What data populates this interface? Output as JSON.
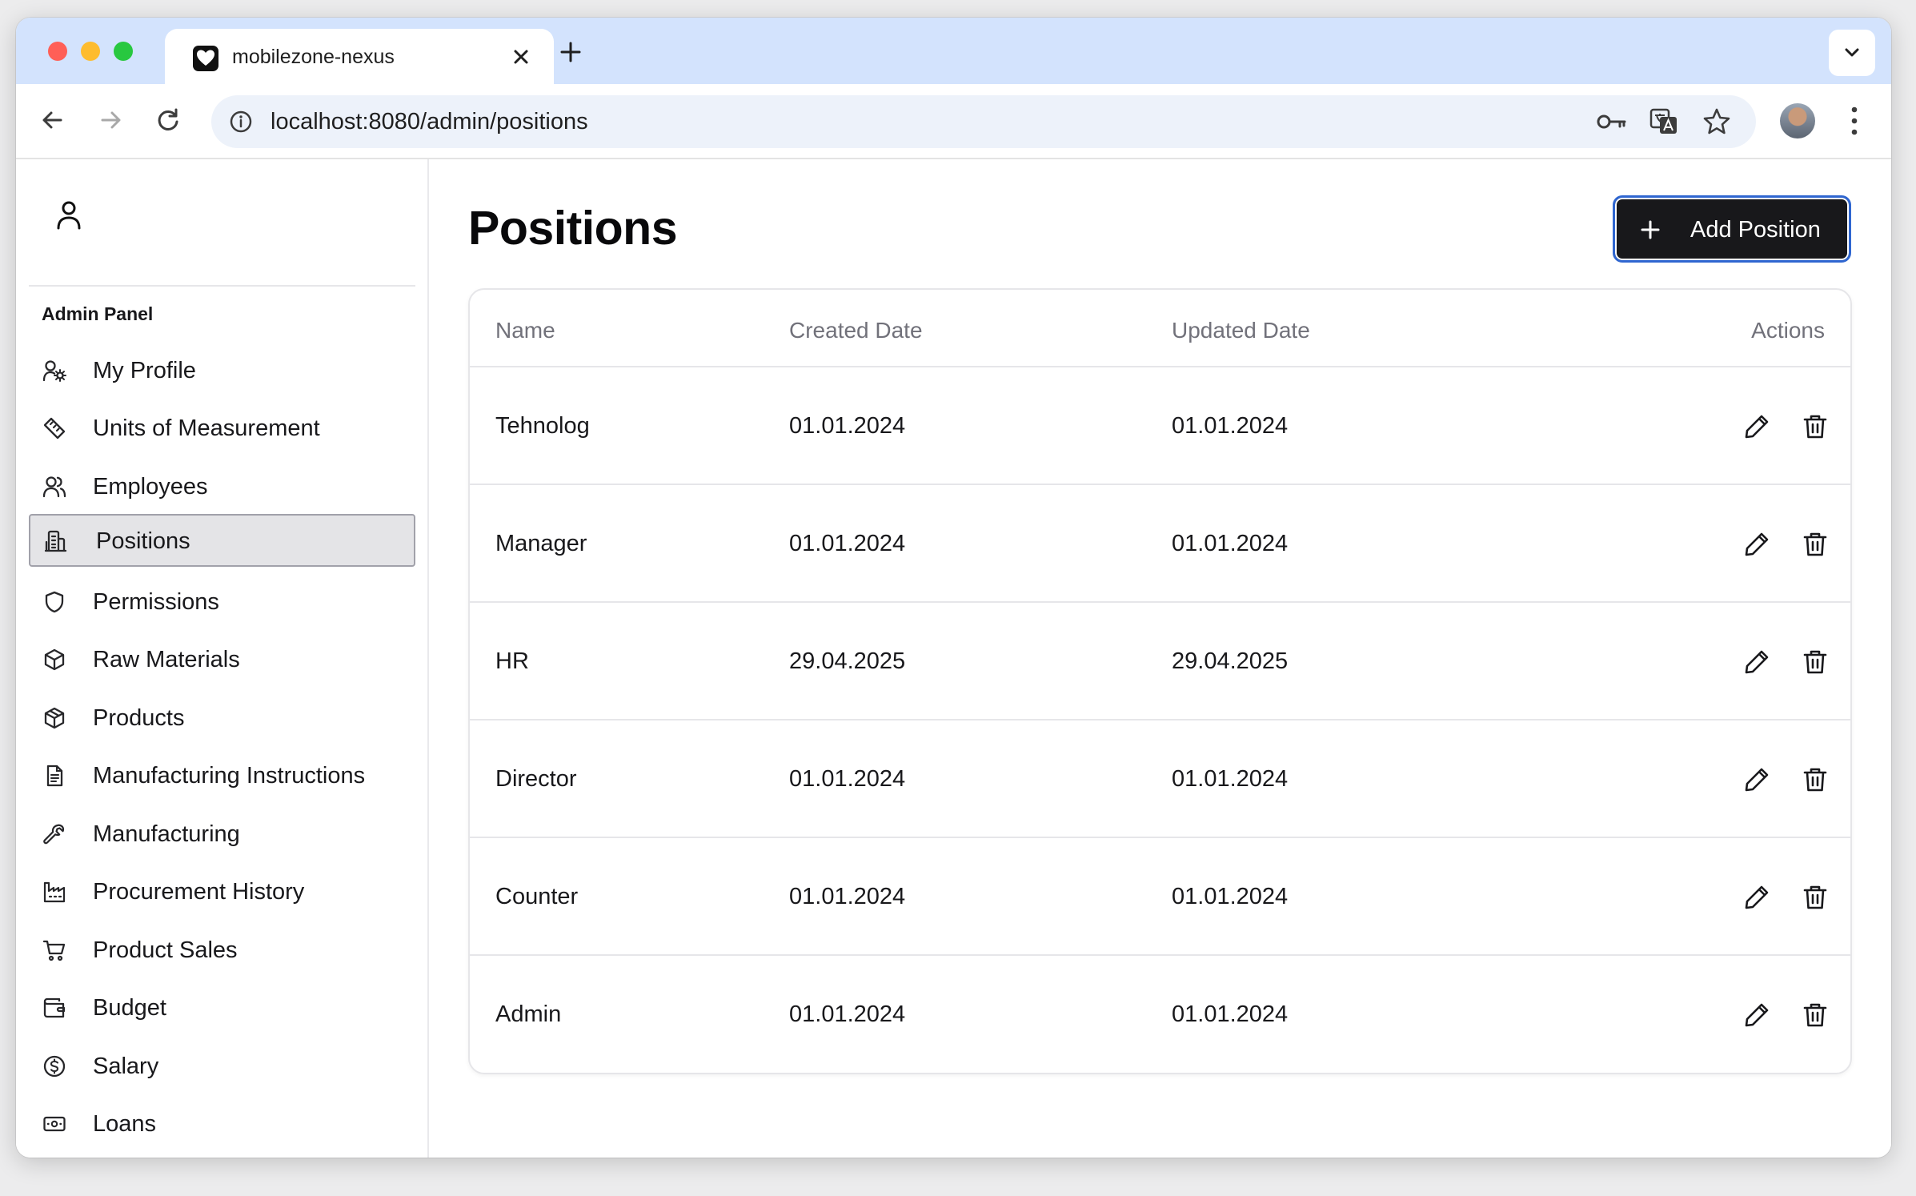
{
  "browser": {
    "tab_title": "mobilezone-nexus",
    "url": "localhost:8080/admin/positions"
  },
  "sidebar": {
    "section_label": "Admin Panel",
    "items": [
      {
        "label": "My Profile",
        "icon": "user-cog-icon"
      },
      {
        "label": "Units of Measurement",
        "icon": "ruler-icon"
      },
      {
        "label": "Employees",
        "icon": "users-icon"
      },
      {
        "label": "Positions",
        "icon": "building-icon",
        "active": true
      },
      {
        "label": "Permissions",
        "icon": "shield-icon"
      },
      {
        "label": "Raw Materials",
        "icon": "box-icon"
      },
      {
        "label": "Products",
        "icon": "package-icon"
      },
      {
        "label": "Manufacturing Instructions",
        "icon": "file-text-icon"
      },
      {
        "label": "Manufacturing",
        "icon": "wrench-icon"
      },
      {
        "label": "Procurement History",
        "icon": "factory-icon"
      },
      {
        "label": "Product Sales",
        "icon": "cart-icon"
      },
      {
        "label": "Budget",
        "icon": "wallet-icon"
      },
      {
        "label": "Salary",
        "icon": "dollar-circle-icon"
      },
      {
        "label": "Loans",
        "icon": "banknote-icon"
      }
    ]
  },
  "main": {
    "title": "Positions",
    "add_button_label": "Add Position",
    "columns": [
      "Name",
      "Created Date",
      "Updated Date",
      "Actions"
    ],
    "rows": [
      {
        "name": "Tehnolog",
        "created": "01.01.2024",
        "updated": "01.01.2024"
      },
      {
        "name": "Manager",
        "created": "01.01.2024",
        "updated": "01.01.2024"
      },
      {
        "name": "HR",
        "created": "29.04.2025",
        "updated": "29.04.2025"
      },
      {
        "name": "Director",
        "created": "01.01.2024",
        "updated": "01.01.2024"
      },
      {
        "name": "Counter",
        "created": "01.01.2024",
        "updated": "01.01.2024"
      },
      {
        "name": "Admin",
        "created": "01.01.2024",
        "updated": "01.01.2024"
      }
    ]
  },
  "colors": {
    "accent": "#18181b",
    "focus_ring": "#2f66d0",
    "tabstrip": "#d3e3fd"
  }
}
